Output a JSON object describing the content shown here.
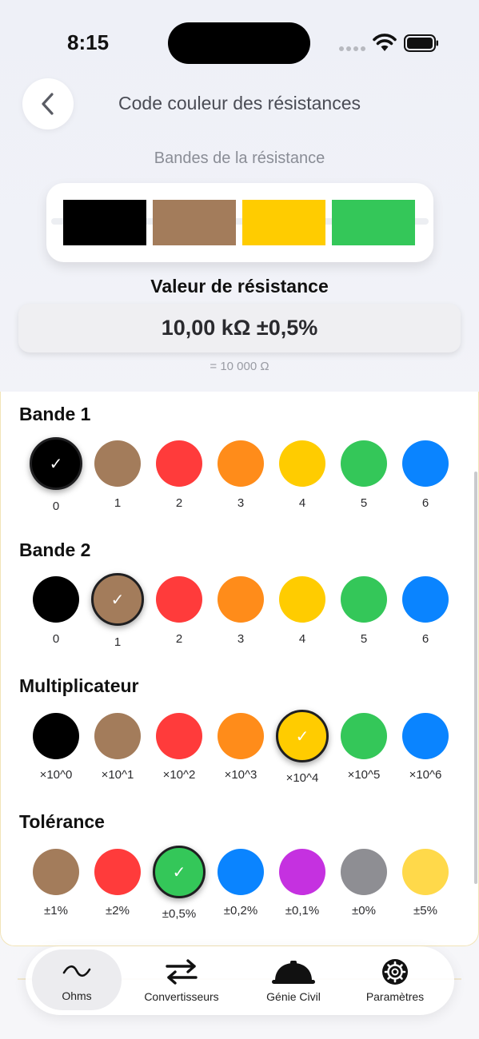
{
  "status_bar": {
    "time": "8:15"
  },
  "header": {
    "title": "Code couleur des résistances"
  },
  "bands_section": {
    "label": "Bandes de la résistance",
    "bands": [
      {
        "name": "black",
        "color": "#000000"
      },
      {
        "name": "brown",
        "color": "#a37c5b"
      },
      {
        "name": "yellow",
        "color": "#ffcc00"
      },
      {
        "name": "green",
        "color": "#34c759"
      }
    ]
  },
  "result": {
    "title": "Valeur de résistance",
    "value": "10,00 kΩ ±0,5%",
    "subvalue": "= 10 000 Ω"
  },
  "groups": [
    {
      "title": "Bande 1",
      "selected": 0,
      "options": [
        {
          "label": "0",
          "color": "#000000"
        },
        {
          "label": "1",
          "color": "#a37c5b"
        },
        {
          "label": "2",
          "color": "#ff3b3b"
        },
        {
          "label": "3",
          "color": "#ff8c1a"
        },
        {
          "label": "4",
          "color": "#ffcc00"
        },
        {
          "label": "5",
          "color": "#34c759"
        },
        {
          "label": "6",
          "color": "#0a84ff"
        }
      ]
    },
    {
      "title": "Bande 2",
      "selected": 1,
      "options": [
        {
          "label": "0",
          "color": "#000000"
        },
        {
          "label": "1",
          "color": "#a37c5b"
        },
        {
          "label": "2",
          "color": "#ff3b3b"
        },
        {
          "label": "3",
          "color": "#ff8c1a"
        },
        {
          "label": "4",
          "color": "#ffcc00"
        },
        {
          "label": "5",
          "color": "#34c759"
        },
        {
          "label": "6",
          "color": "#0a84ff"
        }
      ]
    },
    {
      "title": "Multiplicateur",
      "selected": 4,
      "options": [
        {
          "label": "×10^0",
          "color": "#000000"
        },
        {
          "label": "×10^1",
          "color": "#a37c5b"
        },
        {
          "label": "×10^2",
          "color": "#ff3b3b"
        },
        {
          "label": "×10^3",
          "color": "#ff8c1a"
        },
        {
          "label": "×10^4",
          "color": "#ffcc00"
        },
        {
          "label": "×10^5",
          "color": "#34c759"
        },
        {
          "label": "×10^6",
          "color": "#0a84ff"
        }
      ]
    },
    {
      "title": "Tolérance",
      "selected": 2,
      "options": [
        {
          "label": "±1%",
          "color": "#a37c5b"
        },
        {
          "label": "±2%",
          "color": "#ff3b3b"
        },
        {
          "label": "±0,5%",
          "color": "#34c759"
        },
        {
          "label": "±0,2%",
          "color": "#0a84ff"
        },
        {
          "label": "±0,1%",
          "color": "#c531e0"
        },
        {
          "label": "±0%",
          "color": "#8e8e93"
        },
        {
          "label": "±5%",
          "color": "#ffd94a"
        }
      ]
    }
  ],
  "tabbar": {
    "tabs": [
      {
        "label": "Ohms",
        "icon": "tilde-icon",
        "active": true
      },
      {
        "label": "Convertisseurs",
        "icon": "arrows-swap-icon",
        "active": false
      },
      {
        "label": "Génie Civil",
        "icon": "hard-hat-icon",
        "active": false
      },
      {
        "label": "Paramètres",
        "icon": "gear-icon",
        "active": false
      }
    ]
  }
}
